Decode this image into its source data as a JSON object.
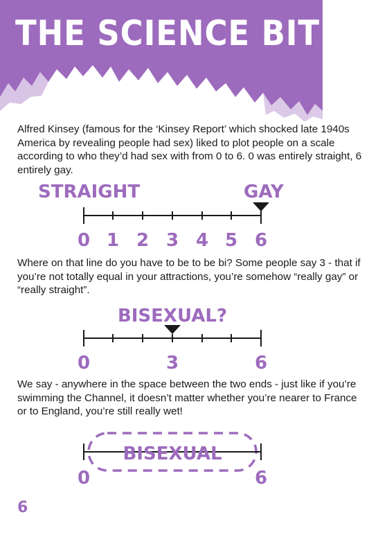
{
  "header": {
    "title": "THE SCIENCE BIT"
  },
  "paragraphs": {
    "intro": "Alfred Kinsey (famous for the ‘Kinsey Report’ which shocked late 1940s America by revealing people had sex) liked to plot people on a scale according to who they’d had sex with from 0 to 6. 0 was entirely straight, 6 entirely gay.",
    "question": "Where on that line do you have to be to be bi? Some people say 3 - that if you’re not totally equal in your attractions, you’re somehow “really gay” or “really straight”.",
    "answer": "We say - anywhere in the space between the two ends - just like if you’re swimming the Channel, it doesn’t matter whether you’re nearer to France or to England, you’re still really wet!"
  },
  "scale1": {
    "left_label": "STRAIGHT",
    "right_label": "GAY",
    "ticks": [
      "0",
      "1",
      "2",
      "3",
      "4",
      "5",
      "6"
    ],
    "marker_at": 6
  },
  "scale2": {
    "label": "BISEXUAL?",
    "ticks": [
      "0",
      "3",
      "6"
    ],
    "marker_at": 3
  },
  "scale3": {
    "label": "BISEXUAL",
    "ticks": [
      "0",
      "6"
    ]
  },
  "page_number": "6",
  "colors": {
    "accent": "#9d6bbd",
    "text": "#1a1a1a",
    "banner_text": "#ffffff"
  }
}
